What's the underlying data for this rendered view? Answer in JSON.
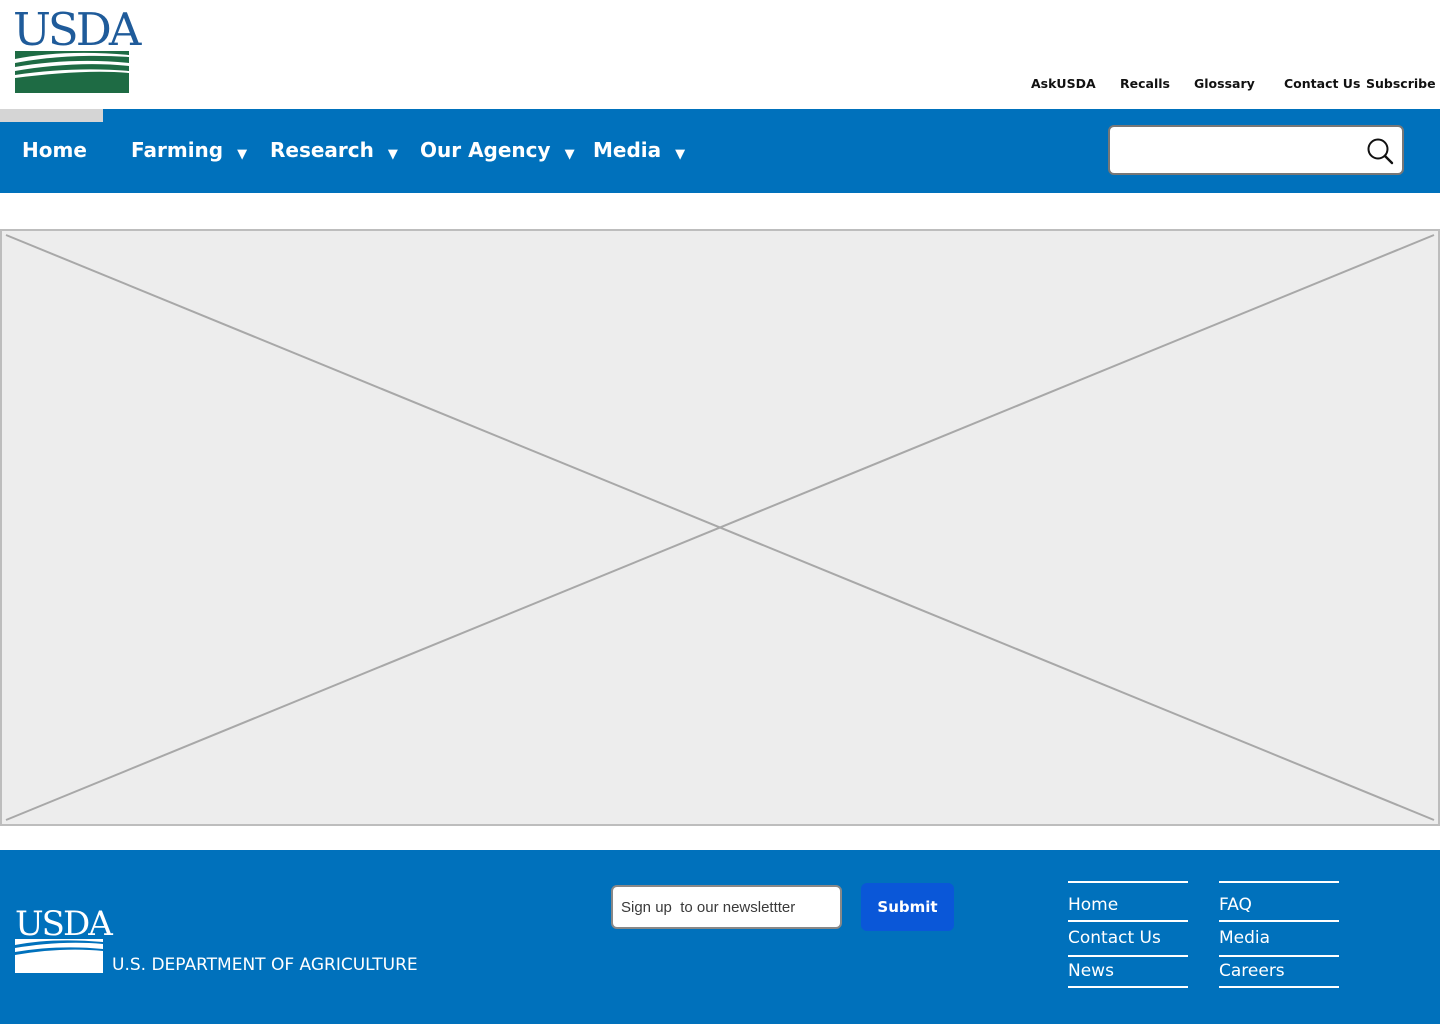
{
  "header": {
    "logo_text": "USDA",
    "utility_links": [
      "AskUSDA",
      "Recalls",
      "Glossary",
      "Contact Us",
      "Subscribe"
    ]
  },
  "nav": {
    "items": [
      {
        "label": "Home",
        "has_dropdown": false
      },
      {
        "label": "Farming",
        "has_dropdown": true
      },
      {
        "label": "Research",
        "has_dropdown": true
      },
      {
        "label": "Our Agency",
        "has_dropdown": true
      },
      {
        "label": "Media",
        "has_dropdown": true
      }
    ],
    "caret": "▼",
    "search": {
      "value": "",
      "placeholder": ""
    }
  },
  "footer": {
    "logo_text": "USDA",
    "department": "U.S. DEPARTMENT OF AGRICULTURE",
    "newsletter": {
      "placeholder": "Sign up  to our newslettter",
      "value": ""
    },
    "submit_label": "Submit",
    "links_col1": [
      "Home",
      "Contact Us",
      "News"
    ],
    "links_col2": [
      "FAQ",
      "Media",
      "Careers"
    ]
  },
  "colors": {
    "brand_blue": "#0071bc",
    "logo_blue": "#1f5b9a",
    "logo_green": "#1e6b44",
    "submit_blue": "#0a57d8",
    "placeholder_gray": "#ededed"
  }
}
